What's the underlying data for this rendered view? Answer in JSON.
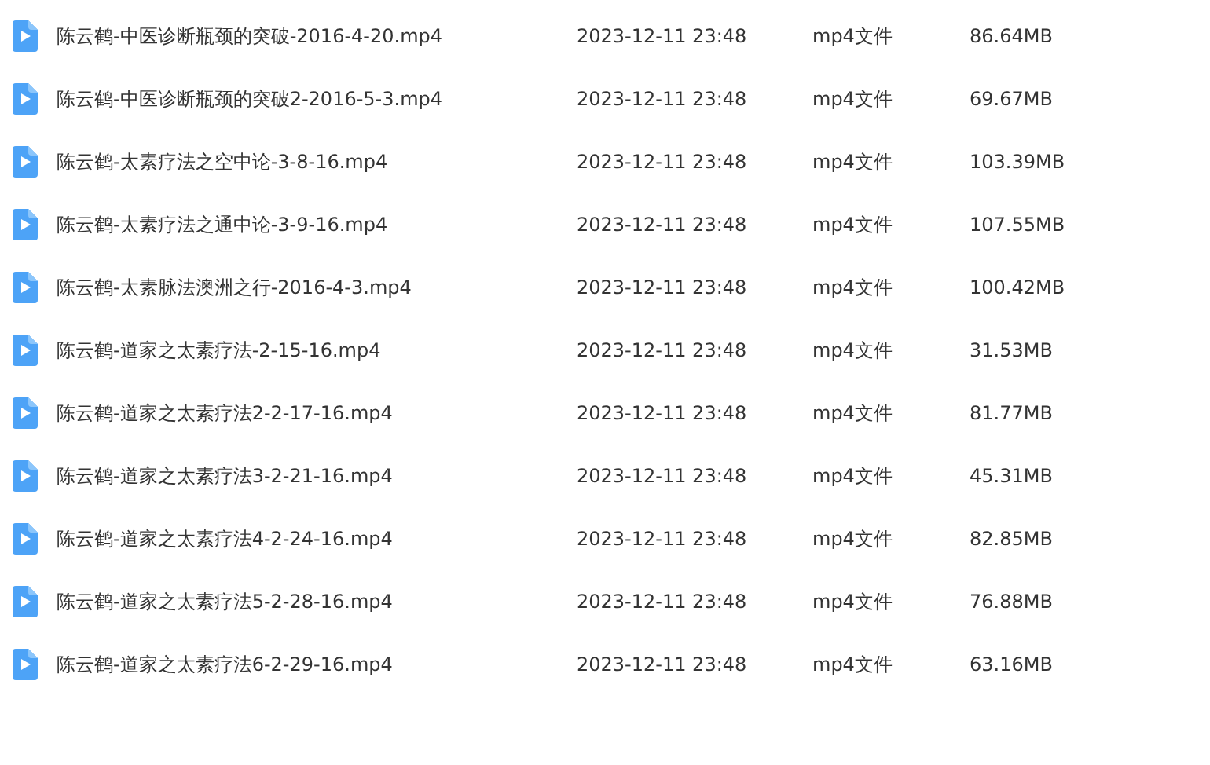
{
  "files": [
    {
      "name": "陈云鹤-中医诊断瓶颈的突破-2016-4-20.mp4",
      "modified": "2023-12-11 23:48",
      "type": "mp4文件",
      "size": "86.64MB"
    },
    {
      "name": "陈云鹤-中医诊断瓶颈的突破2-2016-5-3.mp4",
      "modified": "2023-12-11 23:48",
      "type": "mp4文件",
      "size": "69.67MB"
    },
    {
      "name": "陈云鹤-太素疗法之空中论-3-8-16.mp4",
      "modified": "2023-12-11 23:48",
      "type": "mp4文件",
      "size": "103.39MB"
    },
    {
      "name": "陈云鹤-太素疗法之通中论-3-9-16.mp4",
      "modified": "2023-12-11 23:48",
      "type": "mp4文件",
      "size": "107.55MB"
    },
    {
      "name": "陈云鹤-太素脉法澳洲之行-2016-4-3.mp4",
      "modified": "2023-12-11 23:48",
      "type": "mp4文件",
      "size": "100.42MB"
    },
    {
      "name": "陈云鹤-道家之太素疗法-2-15-16.mp4",
      "modified": "2023-12-11 23:48",
      "type": "mp4文件",
      "size": "31.53MB"
    },
    {
      "name": "陈云鹤-道家之太素疗法2-2-17-16.mp4",
      "modified": "2023-12-11 23:48",
      "type": "mp4文件",
      "size": "81.77MB"
    },
    {
      "name": "陈云鹤-道家之太素疗法3-2-21-16.mp4",
      "modified": "2023-12-11 23:48",
      "type": "mp4文件",
      "size": "45.31MB"
    },
    {
      "name": "陈云鹤-道家之太素疗法4-2-24-16.mp4",
      "modified": "2023-12-11 23:48",
      "type": "mp4文件",
      "size": "82.85MB"
    },
    {
      "name": "陈云鹤-道家之太素疗法5-2-28-16.mp4",
      "modified": "2023-12-11 23:48",
      "type": "mp4文件",
      "size": "76.88MB"
    },
    {
      "name": "陈云鹤-道家之太素疗法6-2-29-16.mp4",
      "modified": "2023-12-11 23:48",
      "type": "mp4文件",
      "size": "63.16MB"
    }
  ]
}
